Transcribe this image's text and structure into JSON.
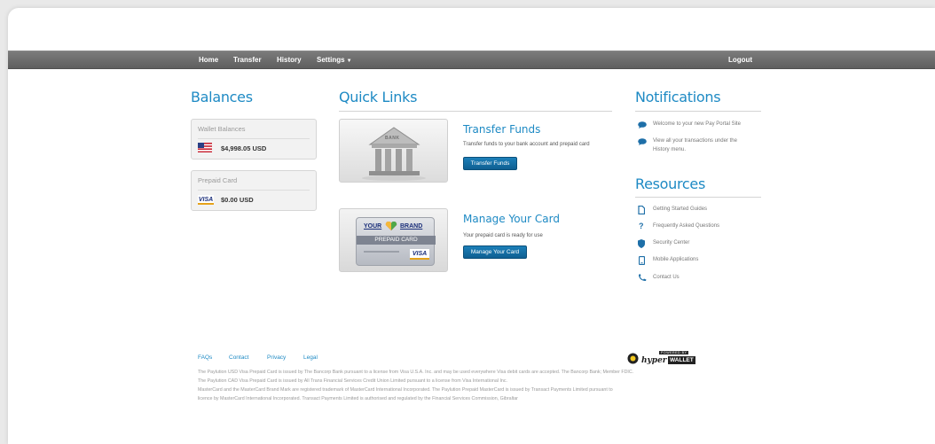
{
  "nav": {
    "home": "Home",
    "transfer": "Transfer",
    "history": "History",
    "settings": "Settings",
    "logout": "Logout"
  },
  "balances": {
    "title": "Balances",
    "wallet": {
      "label": "Wallet Balances",
      "amount": "$4,998.05 USD",
      "icon": "us-flag-icon"
    },
    "prepaid": {
      "label": "Prepaid Card",
      "amount": "$0.00 USD",
      "icon": "visa-icon"
    }
  },
  "quick_links": {
    "title": "Quick Links",
    "transfer": {
      "title": "Transfer Funds",
      "description": "Transfer funds to your bank account and prepaid card",
      "button": "Transfer Funds",
      "image_label": "BANK"
    },
    "card": {
      "title": "Manage Your Card",
      "description": "Your prepaid card is ready for use",
      "button": "Manage Your Card",
      "card_your": "YOUR",
      "card_brand": "BRAND",
      "card_type": "PREPAID CARD",
      "card_visa": "VISA"
    }
  },
  "notifications": {
    "title": "Notifications",
    "items": [
      {
        "line1": "Welcome to your new Pay Portal Site",
        "line2": ""
      },
      {
        "line1": "View all your transactions under the",
        "line2": "History menu."
      }
    ]
  },
  "resources": {
    "title": "Resources",
    "items": [
      {
        "label": "Getting Started Guides",
        "icon": "document-icon"
      },
      {
        "label": "Frequently Asked Questions",
        "icon": "question-icon"
      },
      {
        "label": "Security Center",
        "icon": "shield-icon"
      },
      {
        "label": "Mobile Applications",
        "icon": "mobile-icon"
      },
      {
        "label": "Contact Us",
        "icon": "phone-icon"
      }
    ]
  },
  "footer": {
    "links": {
      "faqs": "FAQs",
      "contact": "Contact",
      "privacy": "Privacy",
      "legal": "Legal"
    },
    "powered_by": "POWERED BY",
    "brand_hyper": "hyper",
    "brand_wallet": "WALLET",
    "lines": [
      "The Paylution USD Visa Prepaid Card is issued by The Bancorp Bank pursuant to a license from Visa U.S.A. Inc. and may be used everywhere Visa debit cards are accepted. The Bancorp Bank; Member FDIC.",
      "The Paylution CAD Visa Prepaid Card is issued by All Trans Financial Services Credit Union Limited pursuant to a license from Visa International Inc.",
      "MasterCard and the MasterCard Brand Mark are registered trademark of MasterCard International Incorporated. The Paylution Prepaid MasterCard is issued by Transact Payments Limited pursuant to",
      "licence by MasterCard International Incorporated. Transact Payments Limited is authorised and regulated by the Financial Services Commission, Gibraltar"
    ]
  },
  "colors": {
    "accent": "#1e8ac4",
    "nav": "#6a6a6a",
    "button": "#12679c"
  }
}
